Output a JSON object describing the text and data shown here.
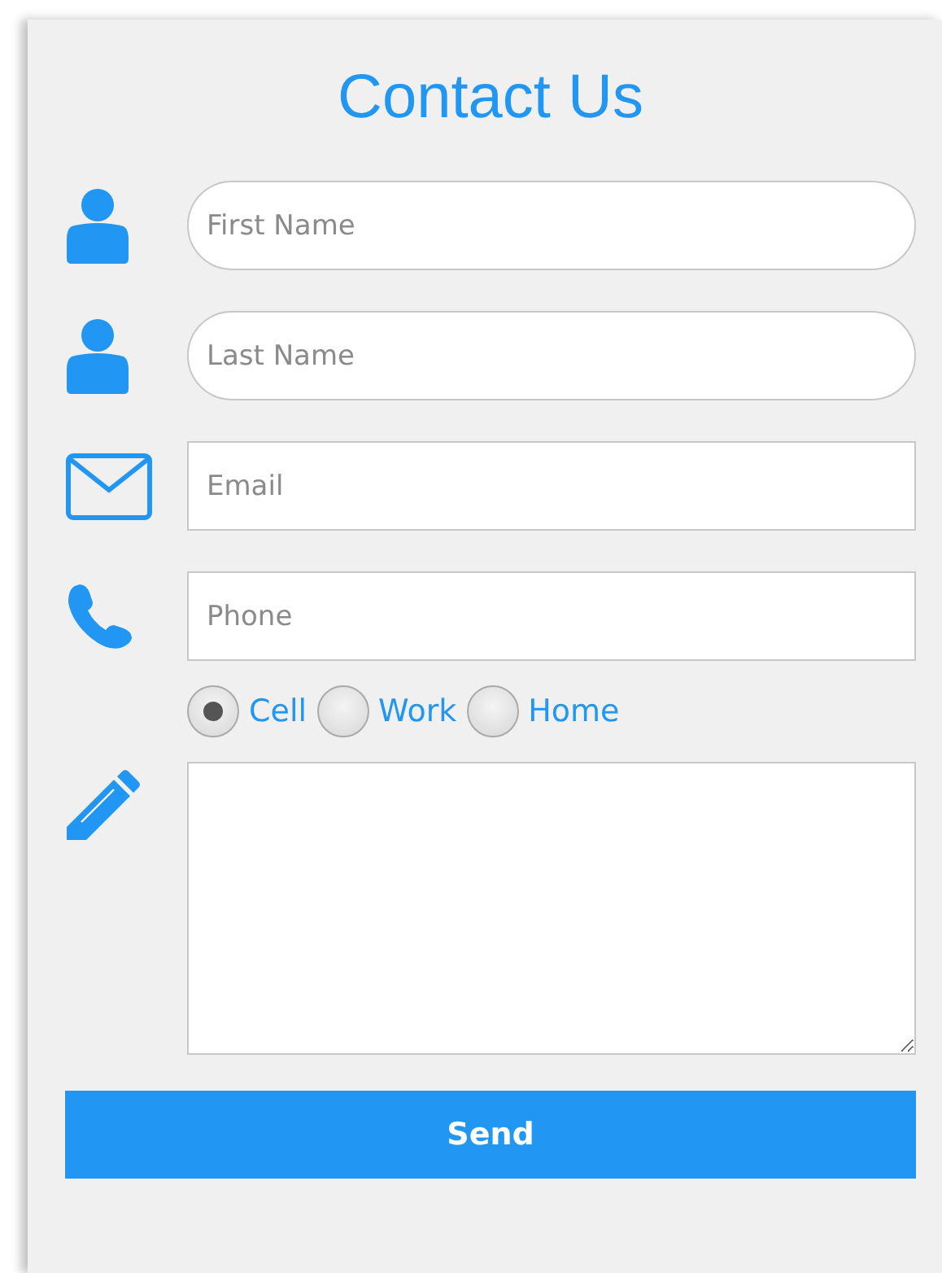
{
  "title": "Contact Us",
  "fields": [
    {
      "kind": "rounded",
      "placeholder": "First Name"
    },
    {
      "kind": "rounded",
      "placeholder": "Last Name"
    },
    {
      "kind": "square",
      "placeholder": "Email"
    },
    {
      "kind": "square",
      "placeholder": "Phone"
    }
  ],
  "phone_type": [
    {
      "label": "Cell",
      "selected": true
    },
    {
      "label": "Work",
      "selected": false
    },
    {
      "label": "Home",
      "selected": false
    }
  ],
  "send_button": "Send"
}
